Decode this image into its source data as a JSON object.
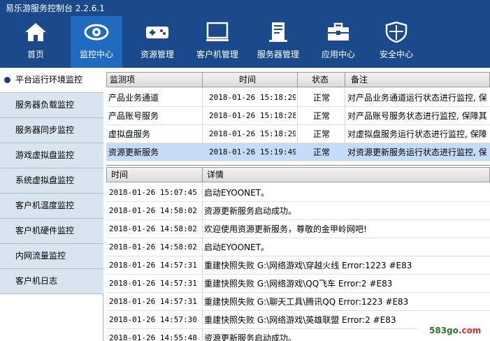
{
  "app": {
    "title": "易乐游服务控制台 2.2.6.1"
  },
  "nav": [
    {
      "label": "首页",
      "icon": "home-icon"
    },
    {
      "label": "监控中心",
      "icon": "eye-icon"
    },
    {
      "label": "资源管理",
      "icon": "gamepad-icon"
    },
    {
      "label": "客户机管理",
      "icon": "monitor-icon"
    },
    {
      "label": "服务器管理",
      "icon": "server-icon"
    },
    {
      "label": "应用中心",
      "icon": "toolbox-icon"
    },
    {
      "label": "安全中心",
      "icon": "shield-icon"
    }
  ],
  "sidebar": {
    "items": [
      {
        "label": "平台运行环境监控"
      },
      {
        "label": "服务器负载监控"
      },
      {
        "label": "服务器同步监控"
      },
      {
        "label": "游戏虚拟盘监控"
      },
      {
        "label": "系统虚拟盘监控"
      },
      {
        "label": "客户机温度监控"
      },
      {
        "label": "客户机硬件监控"
      },
      {
        "label": "内网流量监控"
      },
      {
        "label": "客户机日志"
      }
    ]
  },
  "monitor_table": {
    "headers": [
      "监测项",
      "时间",
      "状态",
      "备注"
    ],
    "rows": [
      {
        "item": "产品业务通道",
        "time": "2018-01-26 15:18:29",
        "status": "正常",
        "note": "对产品业务通道运行状态进行监控, 保"
      },
      {
        "item": "产品账号服务",
        "time": "2018-01-26 15:18:28",
        "status": "正常",
        "note": "对产品账号服务状态进行监控, 保障其"
      },
      {
        "item": "虚拟盘服务",
        "time": "2018-01-26 15:18:29",
        "status": "正常",
        "note": "对虚拟盘服务运行状态进行监控, 保障"
      },
      {
        "item": "资源更新服务",
        "time": "2018-01-26 15:19:49",
        "status": "正常",
        "note": "对资源更新服务运行状态进行监控, 保"
      }
    ]
  },
  "log_table": {
    "headers": [
      "时间",
      "详情"
    ],
    "rows": [
      {
        "time": "2018-01-26 15:07:45",
        "detail": "启动EYOONET。"
      },
      {
        "time": "2018-01-26 14:58:02",
        "detail": "资源更新服务启动成功。"
      },
      {
        "time": "2018-01-26 14:58:02",
        "detail": "欢迎使用资源更新服务，尊敬的金甲岭网吧!"
      },
      {
        "time": "2018-01-26 14:58:02",
        "detail": "启动EYOONET。"
      },
      {
        "time": "2018-01-26 14:57:31",
        "detail": "重建快照失败 G:\\网络游戏\\穿越火线  Error:1223 #E83"
      },
      {
        "time": "2018-01-26 14:57:31",
        "detail": "重建快照失败 G:\\网络游戏\\QQ飞车  Error:2 #E83"
      },
      {
        "time": "2018-01-26 14:57:31",
        "detail": "重建快照失败 G:\\聊天工具\\腾讯QQ  Error:1223 #E83"
      },
      {
        "time": "2018-01-26 14:57:30",
        "detail": "重建快照失败 G:\\网络游戏\\英雄联盟  Error:2 #E83"
      },
      {
        "time": "2018-01-26 14:55:48",
        "detail": "资源更新服务启动成功。"
      }
    ]
  },
  "watermark": {
    "prefix": "583go",
    "suffix": ".com"
  },
  "colors": {
    "header": "#1a4a8c",
    "nav_active": "#1f6bbf",
    "sidebar": "#d8e4ee",
    "selected_row": "#c5dcf8"
  }
}
